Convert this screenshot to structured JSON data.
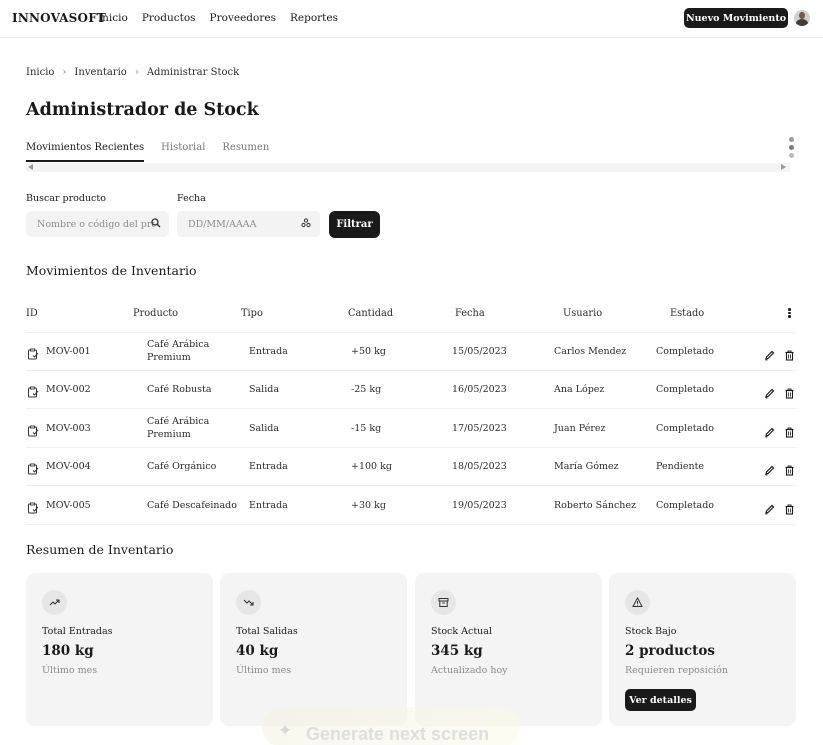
{
  "header": {
    "brand": "INNOVASOFT",
    "nav": [
      "Inicio",
      "Productos",
      "Proveedores",
      "Reportes"
    ],
    "new_button": "Nuevo Movimiento"
  },
  "breadcrumb": [
    "Inicio",
    "Inventario",
    "Administrar Stock"
  ],
  "page_title": "Administrador de Stock",
  "tabs": [
    "Movimientos Recientes",
    "Historial",
    "Resumen"
  ],
  "filters": {
    "search_label": "Buscar producto",
    "search_placeholder": "Nombre o código del producto",
    "date_label": "Fecha",
    "date_placeholder": "DD/MM/AAAA",
    "filter_button": "Filtrar"
  },
  "movements": {
    "title": "Movimientos de Inventario",
    "columns": [
      "ID",
      "Producto",
      "Tipo",
      "Cantidad",
      "Fecha",
      "Usuario",
      "Estado"
    ],
    "rows": [
      {
        "id": "MOV-001",
        "product": "Café Arábica Premium",
        "type": "Entrada",
        "qty": "+50 kg",
        "date": "15/05/2023",
        "user": "Carlos Mendez",
        "status": "Completado"
      },
      {
        "id": "MOV-002",
        "product": "Café Robusta",
        "type": "Salida",
        "qty": "-25 kg",
        "date": "16/05/2023",
        "user": "Ana López",
        "status": "Completado"
      },
      {
        "id": "MOV-003",
        "product": "Café Arábica Premium",
        "type": "Salida",
        "qty": "-15 kg",
        "date": "17/05/2023",
        "user": "Juan Pérez",
        "status": "Completado"
      },
      {
        "id": "MOV-004",
        "product": "Café Orgánico",
        "type": "Entrada",
        "qty": "+100 kg",
        "date": "18/05/2023",
        "user": "María Gómez",
        "status": "Pendiente"
      },
      {
        "id": "MOV-005",
        "product": "Café Descafeinado",
        "type": "Entrada",
        "qty": "+30 kg",
        "date": "19/05/2023",
        "user": "Roberto Sánchez",
        "status": "Completado"
      }
    ]
  },
  "summary": {
    "title": "Resumen de Inventario",
    "cards": [
      {
        "label": "Total Entradas",
        "value": "180 kg",
        "sub": "Último mes",
        "icon": "trending-up-icon"
      },
      {
        "label": "Total Salidas",
        "value": "40 kg",
        "sub": "Último mes",
        "icon": "trending-down-icon"
      },
      {
        "label": "Stock Actual",
        "value": "345 kg",
        "sub": "Actualizado hoy",
        "icon": "archive-icon"
      },
      {
        "label": "Stock Bajo",
        "value": "2 productos",
        "sub": "Requieren reposición",
        "icon": "warning-icon",
        "button": "Ver detalles"
      }
    ]
  },
  "overlay": {
    "generate_label": "Generate next screen"
  }
}
